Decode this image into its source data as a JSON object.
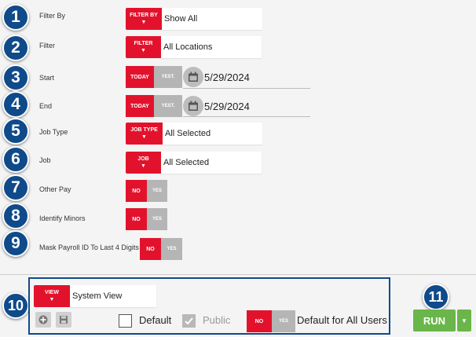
{
  "badges": [
    "1",
    "2",
    "3",
    "4",
    "5",
    "6",
    "7",
    "8",
    "9",
    "10",
    "11"
  ],
  "fields": {
    "filter_by": {
      "label": "Filter By",
      "button": "FILTER BY",
      "value": "Show All"
    },
    "filter": {
      "label": "Filter",
      "button": "FILTER",
      "value": "All Locations"
    },
    "start": {
      "label": "Start",
      "today": "TODAY",
      "yesterday": "YEST.",
      "value": "5/29/2024"
    },
    "end": {
      "label": "End",
      "today": "TODAY",
      "yesterday": "YEST.",
      "value": "5/29/2024"
    },
    "job_type": {
      "label": "Job Type",
      "button": "JOB TYPE",
      "value": "All Selected"
    },
    "job": {
      "label": "Job",
      "button": "JOB",
      "value": "All Selected"
    },
    "other_pay": {
      "label": "Other Pay",
      "no": "NO",
      "yes": "YES"
    },
    "identify_minors": {
      "label": "Identify Minors",
      "no": "NO",
      "yes": "YES"
    },
    "mask_payroll": {
      "label": "Mask Payroll ID To Last 4 Digits",
      "no": "NO",
      "yes": "YES"
    }
  },
  "view": {
    "button": "VIEW",
    "value": "System View",
    "default_label": "Default",
    "public_label": "Public",
    "no": "NO",
    "yes": "YES",
    "default_all_label": "Default for All Users"
  },
  "run": {
    "label": "RUN"
  },
  "colors": {
    "accent": "#e3122c",
    "badge": "#0f4a8a",
    "run": "#6ab64a"
  },
  "icons": [
    "dropdown-caret",
    "calendar-icon",
    "plus-icon",
    "save-icon",
    "check-icon"
  ]
}
